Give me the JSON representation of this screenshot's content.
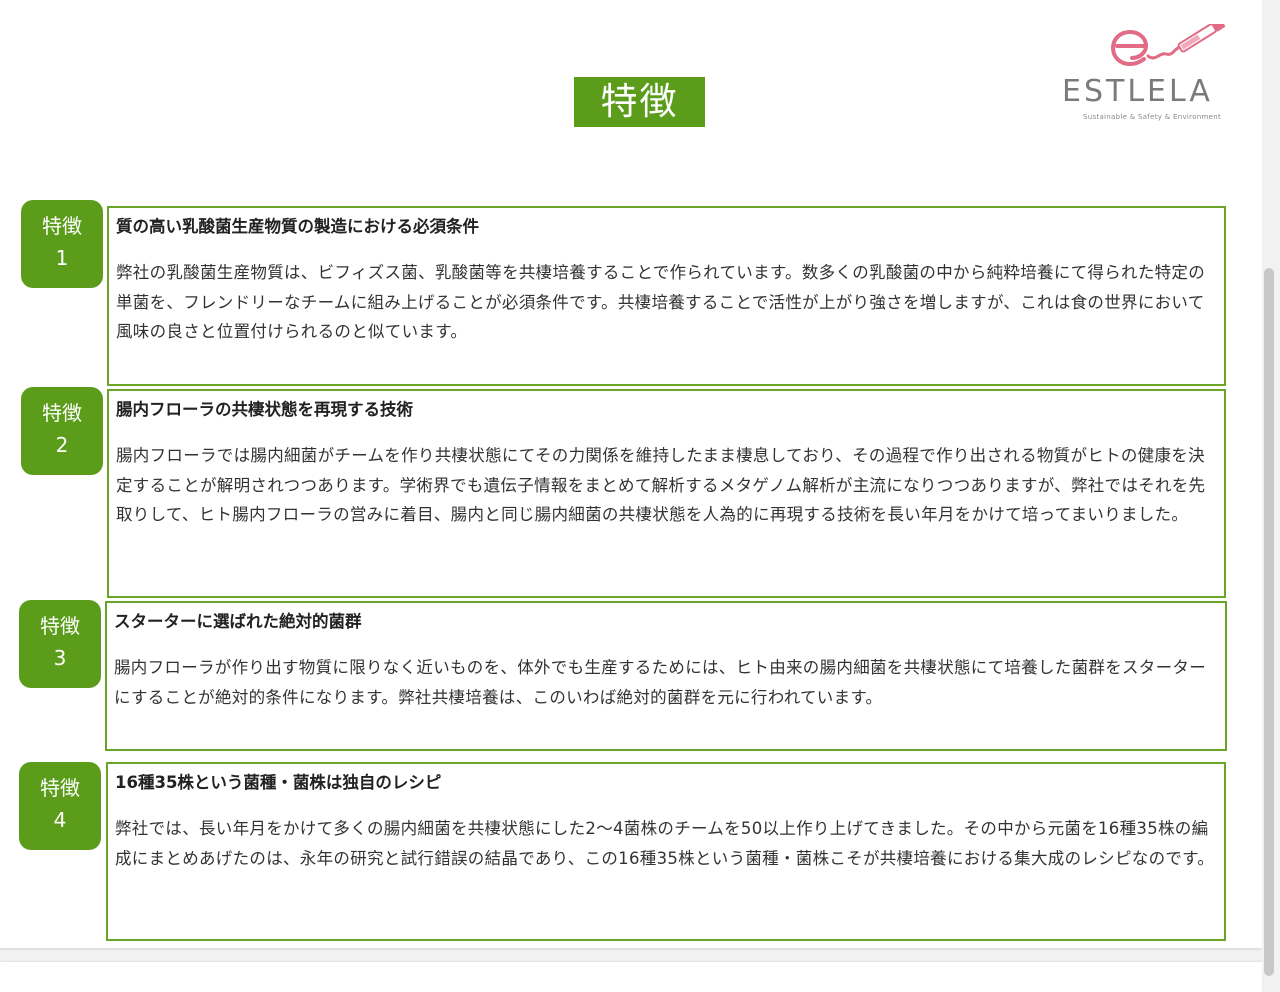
{
  "header": {
    "title": "特徴",
    "logo_text": "ESTLELA",
    "logo_tagline": "Sustainable & Safety & Environment"
  },
  "features": [
    {
      "badge_label": "特徴",
      "badge_number": "1",
      "heading": "質の高い乳酸菌生産物質の製造における必須条件",
      "body": "弊社の乳酸菌生産物質は、ビフィズス菌、乳酸菌等を共棲培養することで作られています。数多くの乳酸菌の中から純粋培養にて得られた特定の単菌を、フレンドリーなチームに組み上げることが必須条件です。共棲培養することで活性が上がり強さを増しますが、これは食の世界において風味の良さと位置付けられるのと似ています。"
    },
    {
      "badge_label": "特徴",
      "badge_number": "2",
      "heading": "腸内フローラの共棲状態を再現する技術",
      "body": "腸内フローラでは腸内細菌がチームを作り共棲状態にてその力関係を維持したまま棲息しており、その過程で作り出される物質がヒトの健康を決定することが解明されつつあります。学術界でも遺伝子情報をまとめて解析するメタゲノム解析が主流になりつつありますが、弊社ではそれを先取りして、ヒト腸内フローラの営みに着目、腸内と同じ腸内細菌の共棲状態を人為的に再現する技術を長い年月をかけて培ってまいりました。"
    },
    {
      "badge_label": "特徴",
      "badge_number": "3",
      "heading": "スターターに選ばれた絶対的菌群",
      "body": "腸内フローラが作り出す物質に限りなく近いものを、体外でも生産するためには、ヒト由来の腸内細菌を共棲状態にて培養した菌群をスターターにすることが絶対的条件になります。弊社共棲培養は、このいわば絶対的菌群を元に行われています。"
    },
    {
      "badge_label": "特徴",
      "badge_number": "4",
      "heading": "16種35株という菌種・菌株は独自のレシピ",
      "body": "弊社では、長い年月をかけて多くの腸内細菌を共棲状態にした2〜4菌株のチームを50以上作り上げてきました。その中から元菌を16種35株の編成にまとめあげたのは、永年の研究と試行錯誤の結晶であり、この16種35株という菌種・菌株こそが共棲培養における集大成のレシピなのです。"
    }
  ],
  "colors": {
    "accent_green": "#5b9c1a",
    "border_green": "#6aa52a",
    "logo_pink": "#e26b86",
    "logo_gray": "#7a7a7a"
  }
}
